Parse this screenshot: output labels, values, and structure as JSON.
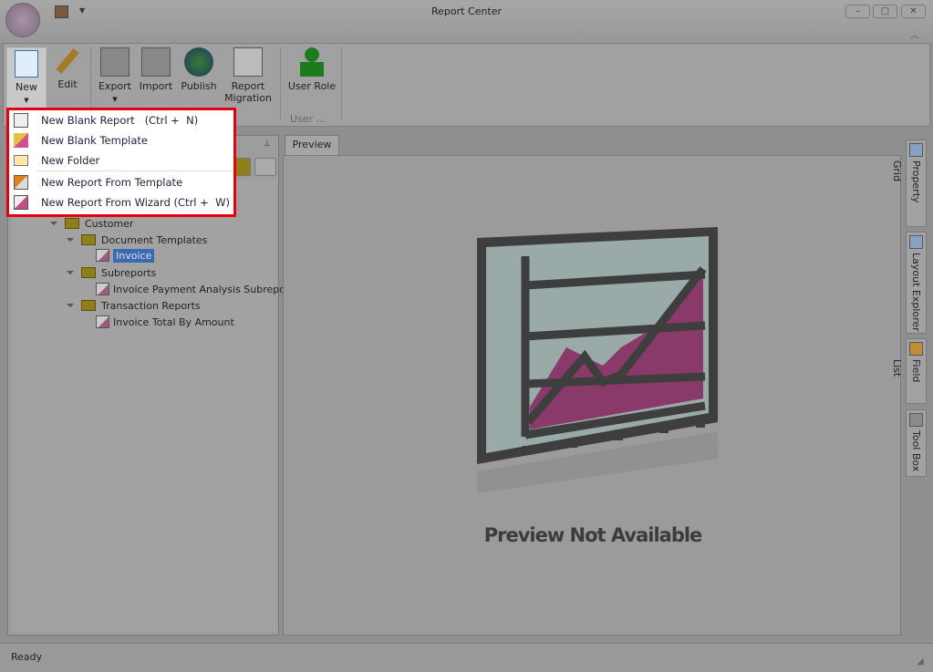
{
  "window": {
    "title": "Report Center",
    "minimize": "–",
    "maximize": "□",
    "close": "✕"
  },
  "ribbon": {
    "buttons": [
      {
        "label": "New"
      },
      {
        "label": "Edit"
      },
      {
        "label": "Export"
      },
      {
        "label": "Import"
      },
      {
        "label": "Publish"
      },
      {
        "label": "Report Migration"
      },
      {
        "label": "User Role"
      }
    ],
    "group_user": "User ..."
  },
  "new_menu": {
    "items": [
      {
        "label": "New Blank Report   (Ctrl +  N)"
      },
      {
        "label": "New Blank Template"
      },
      {
        "label": "New Folder"
      },
      {
        "label": "New Report From Template"
      },
      {
        "label": "New Report From Wizard (Ctrl +  W)"
      }
    ]
  },
  "tree": [
    {
      "label": "Customer"
    },
    {
      "label": "Document Templates"
    },
    {
      "label": "Invoice"
    },
    {
      "label": "Subreports"
    },
    {
      "label": "Invoice Payment Analysis Subreport"
    },
    {
      "label": "Transaction Reports"
    },
    {
      "label": "Invoice Total By Amount"
    }
  ],
  "preview": {
    "tab": "Preview",
    "message": "Preview Not Available"
  },
  "side_tabs": [
    "Property Grid",
    "Layout Explorer",
    "Field List",
    "Tool Box"
  ],
  "status": "Ready"
}
